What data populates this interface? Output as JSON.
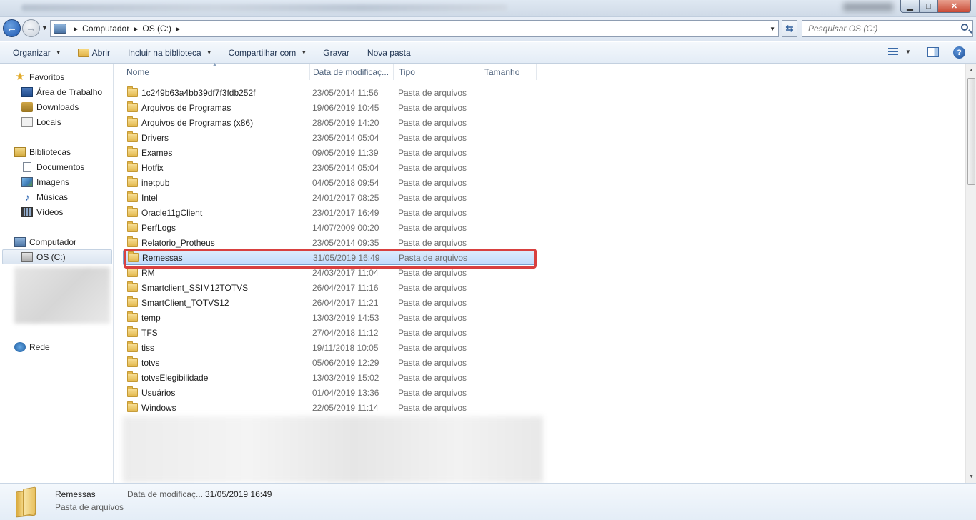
{
  "window": {
    "controls": {
      "minimize": "▁",
      "maximize": "□",
      "close": "✕"
    }
  },
  "address": {
    "crumbs": [
      "Computador",
      "OS (C:)"
    ]
  },
  "search": {
    "placeholder": "Pesquisar OS (C:)"
  },
  "toolbar": {
    "organize": "Organizar",
    "open": "Abrir",
    "include_library": "Incluir na biblioteca",
    "share": "Compartilhar com",
    "burn": "Gravar",
    "new_folder": "Nova pasta",
    "help": "?"
  },
  "nav": {
    "favorites": "Favoritos",
    "desktop": "Área de Trabalho",
    "downloads": "Downloads",
    "places": "Locais",
    "libraries": "Bibliotecas",
    "documents": "Documentos",
    "images": "Imagens",
    "music": "Músicas",
    "videos": "Vídeos",
    "computer": "Computador",
    "drive": "OS (C:)",
    "network": "Rede"
  },
  "columns": {
    "name": "Nome",
    "date": "Data de modificaç...",
    "type": "Tipo",
    "size": "Tamanho"
  },
  "files": [
    {
      "name": "1c249b63a4bb39df7f3fdb252f",
      "date": "23/05/2014 11:56",
      "type": "Pasta de arquivos"
    },
    {
      "name": "Arquivos de Programas",
      "date": "19/06/2019 10:45",
      "type": "Pasta de arquivos"
    },
    {
      "name": "Arquivos de Programas (x86)",
      "date": "28/05/2019 14:20",
      "type": "Pasta de arquivos"
    },
    {
      "name": "Drivers",
      "date": "23/05/2014 05:04",
      "type": "Pasta de arquivos"
    },
    {
      "name": "Exames",
      "date": "09/05/2019 11:39",
      "type": "Pasta de arquivos"
    },
    {
      "name": "Hotfix",
      "date": "23/05/2014 05:04",
      "type": "Pasta de arquivos"
    },
    {
      "name": "inetpub",
      "date": "04/05/2018 09:54",
      "type": "Pasta de arquivos"
    },
    {
      "name": "Intel",
      "date": "24/01/2017 08:25",
      "type": "Pasta de arquivos"
    },
    {
      "name": "Oracle11gClient",
      "date": "23/01/2017 16:49",
      "type": "Pasta de arquivos"
    },
    {
      "name": "PerfLogs",
      "date": "14/07/2009 00:20",
      "type": "Pasta de arquivos"
    },
    {
      "name": "Relatorio_Protheus",
      "date": "23/05/2014 09:35",
      "type": "Pasta de arquivos"
    },
    {
      "name": "Remessas",
      "date": "31/05/2019 16:49",
      "type": "Pasta de arquivos"
    },
    {
      "name": "RM",
      "date": "24/03/2017 11:04",
      "type": "Pasta de arquivos"
    },
    {
      "name": "Smartclient_SSIM12TOTVS",
      "date": "26/04/2017 11:16",
      "type": "Pasta de arquivos"
    },
    {
      "name": "SmartClient_TOTVS12",
      "date": "26/04/2017 11:21",
      "type": "Pasta de arquivos"
    },
    {
      "name": "temp",
      "date": "13/03/2019 14:53",
      "type": "Pasta de arquivos"
    },
    {
      "name": "TFS",
      "date": "27/04/2018 11:12",
      "type": "Pasta de arquivos"
    },
    {
      "name": "tiss",
      "date": "19/11/2018 10:05",
      "type": "Pasta de arquivos"
    },
    {
      "name": "totvs",
      "date": "05/06/2019 12:29",
      "type": "Pasta de arquivos"
    },
    {
      "name": "totvsElegibilidade",
      "date": "13/03/2019 15:02",
      "type": "Pasta de arquivos"
    },
    {
      "name": "Usuários",
      "date": "01/04/2019 13:36",
      "type": "Pasta de arquivos"
    },
    {
      "name": "Windows",
      "date": "22/05/2019 11:14",
      "type": "Pasta de arquivos"
    }
  ],
  "details": {
    "name": "Remessas",
    "type": "Pasta de arquivos",
    "date_label": "Data de modificaç...",
    "date_value": "31/05/2019 16:49"
  },
  "colors": {
    "selection": "#c1dbfc",
    "highlight_box": "#d8403f",
    "folder": "#e2b64a"
  }
}
